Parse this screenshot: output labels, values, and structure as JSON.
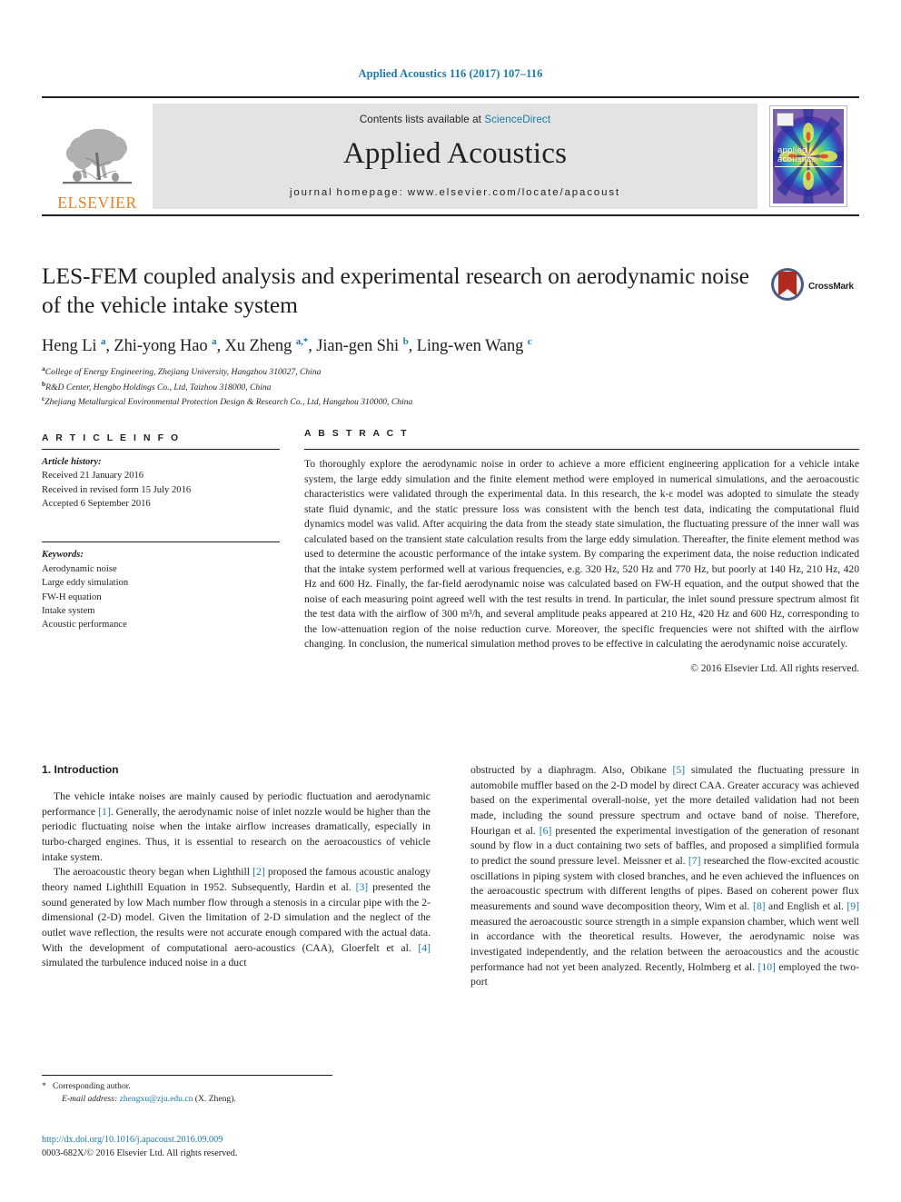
{
  "running_head": "Applied Acoustics 116 (2017) 107–116",
  "masthead": {
    "publisher_logo_label": "ELSEVIER",
    "contents_prefix": "Contents lists available at ",
    "sciencedirect": "ScienceDirect",
    "journal_title": "Applied Acoustics",
    "homepage": "journal homepage: www.elsevier.com/locate/apacoust",
    "cover_title_line1": "applied",
    "cover_title_line2": "acoustics"
  },
  "article": {
    "title": "LES-FEM coupled analysis and experimental research on aerodynamic noise of the vehicle intake system",
    "crossmark_label": "CrossMark",
    "authors_html": "Heng Li <sup>a</sup>, Zhi-yong Hao <sup>a</sup>, Xu Zheng <sup>a,*</sup>, Jian-gen Shi <sup>b</sup>, Ling-wen Wang <sup>c</sup>",
    "affiliations": [
      {
        "marker": "a",
        "text": "College of Energy Engineering, Zhejiang University, Hangzhou 310027, China"
      },
      {
        "marker": "b",
        "text": "R&D Center, Hengbo Holdings Co., Ltd, Taizhou 318000, China"
      },
      {
        "marker": "c",
        "text": "Zhejiang Metallurgical Environmental Protection Design & Research Co., Ltd, Hangzhou 310000, China"
      }
    ]
  },
  "info": {
    "heading": "A R T I C L E    I N F O",
    "history_label": "Article history:",
    "history": [
      "Received 21 January 2016",
      "Received in revised form 15 July 2016",
      "Accepted 6 September 2016"
    ],
    "keywords_label": "Keywords:",
    "keywords": [
      "Aerodynamic noise",
      "Large eddy simulation",
      "FW-H equation",
      "Intake system",
      "Acoustic performance"
    ]
  },
  "abstract": {
    "heading": "A B S T R A C T",
    "text": "To thoroughly explore the aerodynamic noise in order to achieve a more efficient engineering application for a vehicle intake system, the large eddy simulation and the finite element method were employed in numerical simulations, and the aeroacoustic characteristics were validated through the experimental data. In this research, the k-ε model was adopted to simulate the steady state fluid dynamic, and the static pressure loss was consistent with the bench test data, indicating the computational fluid dynamics model was valid. After acquiring the data from the steady state simulation, the fluctuating pressure of the inner wall was calculated based on the transient state calculation results from the large eddy simulation. Thereafter, the finite element method was used to determine the acoustic performance of the intake system. By comparing the experiment data, the noise reduction indicated that the intake system performed well at various frequencies, e.g. 320 Hz, 520 Hz and 770 Hz, but poorly at 140 Hz, 210 Hz, 420 Hz and 600 Hz. Finally, the far-field aerodynamic noise was calculated based on FW-H equation, and the output showed that the noise of each measuring point agreed well with the test results in trend. In particular, the inlet sound pressure spectrum almost fit the test data with the airflow of 300 m³/h, and several amplitude peaks appeared at 210 Hz, 420 Hz and 600 Hz, corresponding to the low-attenuation region of the noise reduction curve. Moreover, the specific frequencies were not shifted with the airflow changing. In conclusion, the numerical simulation method proves to be effective in calculating the aerodynamic noise accurately.",
    "copyright": "© 2016 Elsevier Ltd. All rights reserved."
  },
  "body": {
    "section_heading": "1. Introduction",
    "left_paragraphs": [
      "The vehicle intake noises are mainly caused by periodic fluctuation and aerodynamic performance [1]. Generally, the aerodynamic noise of inlet nozzle would be higher than the periodic fluctuating noise when the intake airflow increases dramatically, especially in turbo-charged engines. Thus, it is essential to research on the aeroacoustics of vehicle intake system.",
      "The aeroacoustic theory began when Lighthill [2] proposed the famous acoustic analogy theory named Lighthill Equation in 1952. Subsequently, Hardin et al. [3] presented the sound generated by low Mach number flow through a stenosis in a circular pipe with the 2-dimensional (2-D) model. Given the limitation of 2-D simulation and the neglect of the outlet wave reflection, the results were not accurate enough compared with the actual data. With the development of computational aero-acoustics (CAA), Gloerfelt et al. [4] simulated the turbulence induced noise in a duct"
    ],
    "right_paragraphs": [
      "obstructed by a diaphragm. Also, Obikane [5] simulated the fluctuating pressure in automobile muffler based on the 2-D model by direct CAA. Greater accuracy was achieved based on the experimental overall-noise, yet the more detailed validation had not been made, including the sound pressure spectrum and octave band of noise. Therefore, Hourigan et al. [6] presented the experimental investigation of the generation of resonant sound by flow in a duct containing two sets of baffles, and proposed a simplified formula to predict the sound pressure level. Meissner et al. [7] researched the flow-excited acoustic oscillations in piping system with closed branches, and he even achieved the influences on the aeroacoustic spectrum with different lengths of pipes. Based on coherent power flux measurements and sound wave decomposition theory, Wim et al. [8] and English et al. [9] measured the aeroacoustic source strength in a simple expansion chamber, which went well in accordance with the theoretical results. However, the aerodynamic noise was investigated independently, and the relation between the aeroacoustics and the acoustic performance had not yet been analyzed. Recently, Holmberg et al. [10] employed the two-port"
    ]
  },
  "footnote": {
    "corresponding": "Corresponding author.",
    "email_label": "E-mail address:",
    "email": "zhengxu@zju.edu.cn",
    "email_suffix": "(X. Zheng)."
  },
  "footer": {
    "doi": "http://dx.doi.org/10.1016/j.apacoust.2016.09.009",
    "issn_line": "0003-682X/© 2016 Elsevier Ltd. All rights reserved."
  },
  "colors": {
    "link": "#1a7aa8",
    "elsevier_orange": "#ef7d20",
    "band_gray": "#e3e3e3",
    "text": "#231f20"
  }
}
